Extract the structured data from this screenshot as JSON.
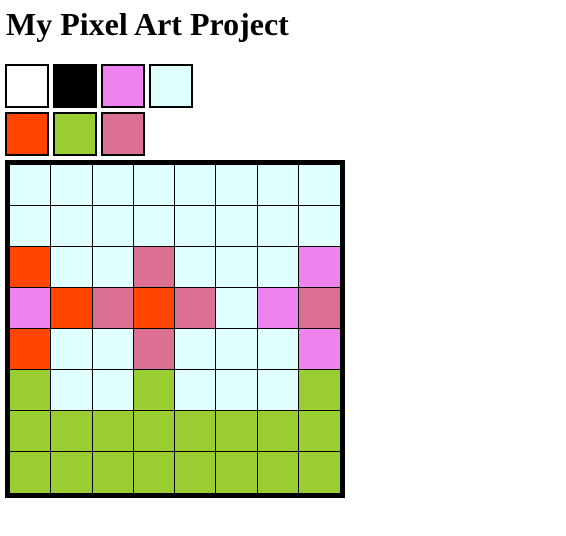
{
  "page": {
    "title": "My Pixel Art Project"
  },
  "palette": {
    "rows": [
      [
        "#ffffff",
        "#000000",
        "#ee82ee",
        "#e0ffff"
      ],
      [
        "#ff4500",
        "#9acd32",
        "#db7093"
      ]
    ]
  },
  "canvas": {
    "columns": 8,
    "rows": 8,
    "pixels": [
      [
        "#e0ffff",
        "#e0ffff",
        "#e0ffff",
        "#e0ffff",
        "#e0ffff",
        "#e0ffff",
        "#e0ffff",
        "#e0ffff"
      ],
      [
        "#e0ffff",
        "#e0ffff",
        "#e0ffff",
        "#e0ffff",
        "#e0ffff",
        "#e0ffff",
        "#e0ffff",
        "#e0ffff"
      ],
      [
        "#ff4500",
        "#e0ffff",
        "#e0ffff",
        "#db7093",
        "#e0ffff",
        "#e0ffff",
        "#e0ffff",
        "#ee82ee"
      ],
      [
        "#ee82ee",
        "#ff4500",
        "#db7093",
        "#ff4500",
        "#db7093",
        "#e0ffff",
        "#ee82ee",
        "#db7093"
      ],
      [
        "#ff4500",
        "#e0ffff",
        "#e0ffff",
        "#db7093",
        "#e0ffff",
        "#e0ffff",
        "#e0ffff",
        "#ee82ee"
      ],
      [
        "#9acd32",
        "#e0ffff",
        "#e0ffff",
        "#9acd32",
        "#e0ffff",
        "#e0ffff",
        "#e0ffff",
        "#9acd32"
      ],
      [
        "#9acd32",
        "#9acd32",
        "#9acd32",
        "#9acd32",
        "#9acd32",
        "#9acd32",
        "#9acd32",
        "#9acd32"
      ],
      [
        "#9acd32",
        "#9acd32",
        "#9acd32",
        "#9acd32",
        "#9acd32",
        "#9acd32",
        "#9acd32",
        "#9acd32"
      ]
    ]
  }
}
